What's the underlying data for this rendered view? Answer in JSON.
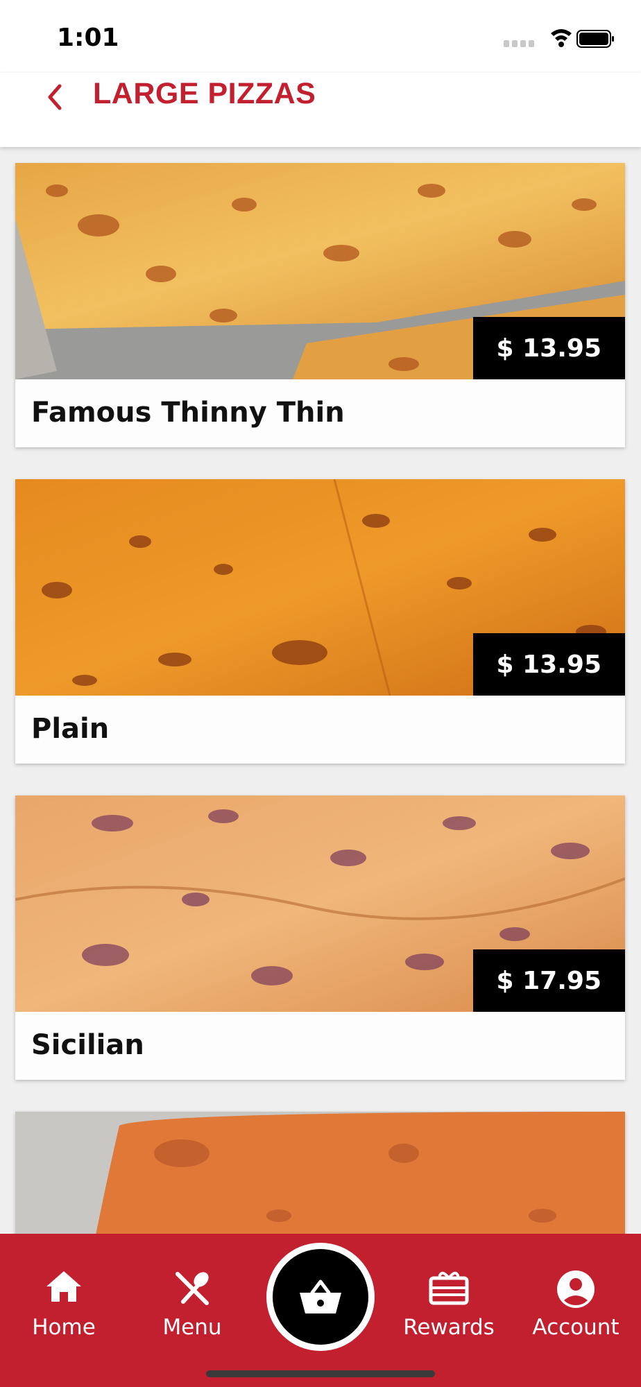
{
  "status": {
    "time": "1:01"
  },
  "header": {
    "title": "LARGE PIZZAS"
  },
  "items": [
    {
      "name": "Famous Thinny Thin",
      "price": "$ 13.95"
    },
    {
      "name": "Plain",
      "price": "$ 13.95"
    },
    {
      "name": "Sicilian",
      "price": "$ 17.95"
    },
    {
      "name": "",
      "price": ""
    }
  ],
  "tabs": {
    "home": "Home",
    "menu": "Menu",
    "rewards": "Rewards",
    "account": "Account"
  },
  "colors": {
    "accent": "#c21f2f",
    "price_bg": "#000000"
  },
  "icons": [
    "back-chevron-icon",
    "signal-icon",
    "wifi-icon",
    "battery-icon",
    "home-icon",
    "utensils-icon",
    "basket-icon",
    "gift-card-icon",
    "account-icon"
  ]
}
